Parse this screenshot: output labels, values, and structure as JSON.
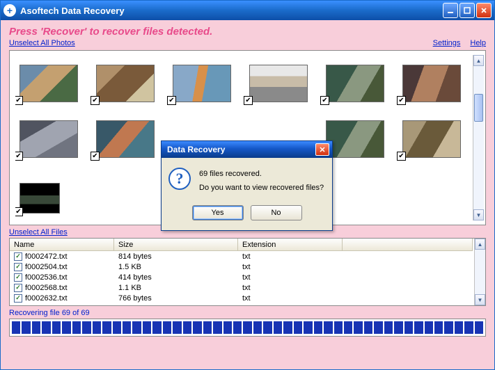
{
  "app": {
    "title": "Asoftech Data Recovery",
    "instruction": "Press 'Recover' to recover files detected."
  },
  "links": {
    "unselect_photos": "Unselect All Photos",
    "unselect_files": "Unselect All Files",
    "settings": "Settings",
    "help": "Help"
  },
  "photos": {
    "count_visible": 10
  },
  "files": {
    "columns": {
      "name": "Name",
      "size": "Size",
      "ext": "Extension"
    },
    "rows": [
      {
        "name": "f0002472.txt",
        "size": "814 bytes",
        "ext": "txt"
      },
      {
        "name": "f0002504.txt",
        "size": "1.5 KB",
        "ext": "txt"
      },
      {
        "name": "f0002536.txt",
        "size": "414 bytes",
        "ext": "txt"
      },
      {
        "name": "f0002568.txt",
        "size": "1.1 KB",
        "ext": "txt"
      },
      {
        "name": "f0002632.txt",
        "size": "766 bytes",
        "ext": "txt"
      }
    ]
  },
  "status": "Recovering file 69 of 69",
  "progress": {
    "segments": 47,
    "filled": 47
  },
  "dialog": {
    "title": "Data Recovery",
    "line1": "69 files recovered.",
    "line2": "Do you want to view recovered files?",
    "yes": "Yes",
    "no": "No"
  }
}
